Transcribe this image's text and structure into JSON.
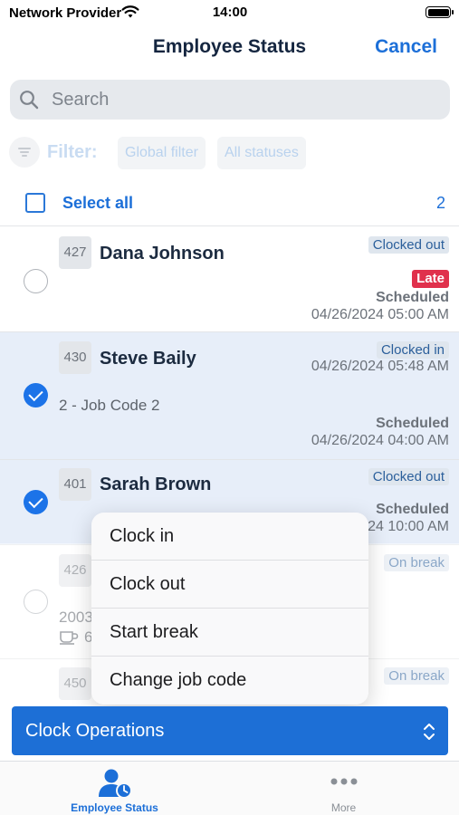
{
  "status_bar": {
    "carrier": "Network Provider",
    "time": "14:00"
  },
  "nav": {
    "title": "Employee Status",
    "cancel_label": "Cancel"
  },
  "search": {
    "placeholder": "Search",
    "value": ""
  },
  "filter": {
    "label": "Filter:",
    "chips": [
      "Global filter",
      "All statuses"
    ]
  },
  "select_all": {
    "label": "Select all",
    "count": "2"
  },
  "employees": [
    {
      "id": "427",
      "name": "Dana Johnson",
      "status": "Clocked out",
      "late": "Late",
      "scheduled_label": "Scheduled",
      "scheduled_date": "04/26/2024 05:00 AM",
      "selected": false
    },
    {
      "id": "430",
      "name": "Steve Baily",
      "status": "Clocked in",
      "status_date": "04/26/2024 05:48 AM",
      "job_code": "2 - Job Code 2",
      "scheduled_label": "Scheduled",
      "scheduled_date": "04/26/2024 04:00 AM",
      "selected": true
    },
    {
      "id": "401",
      "name": "Sarah Brown",
      "status": "Clocked out",
      "scheduled_label": "Scheduled",
      "scheduled_date_partial": "24 10:00 AM",
      "selected": true
    },
    {
      "id": "426",
      "status": "On break",
      "partial_text": "2003",
      "partial_break": "6",
      "selected": false
    },
    {
      "id": "450",
      "status": "On break",
      "selected": false
    }
  ],
  "context_menu": {
    "items": [
      "Clock in",
      "Clock out",
      "Start break",
      "Change job code"
    ]
  },
  "clock_operations": {
    "label": "Clock Operations"
  },
  "tab_bar": {
    "tabs": [
      {
        "label": "Employee Status",
        "icon": "employee-clock-icon",
        "active": true
      },
      {
        "label": "More",
        "icon": "more-dots-icon",
        "active": false
      }
    ]
  },
  "colors": {
    "accent": "#1c6fd8",
    "selected_row": "#e7eef9",
    "late_badge": "#e0314c",
    "button_blue": "#1d6fd6"
  }
}
